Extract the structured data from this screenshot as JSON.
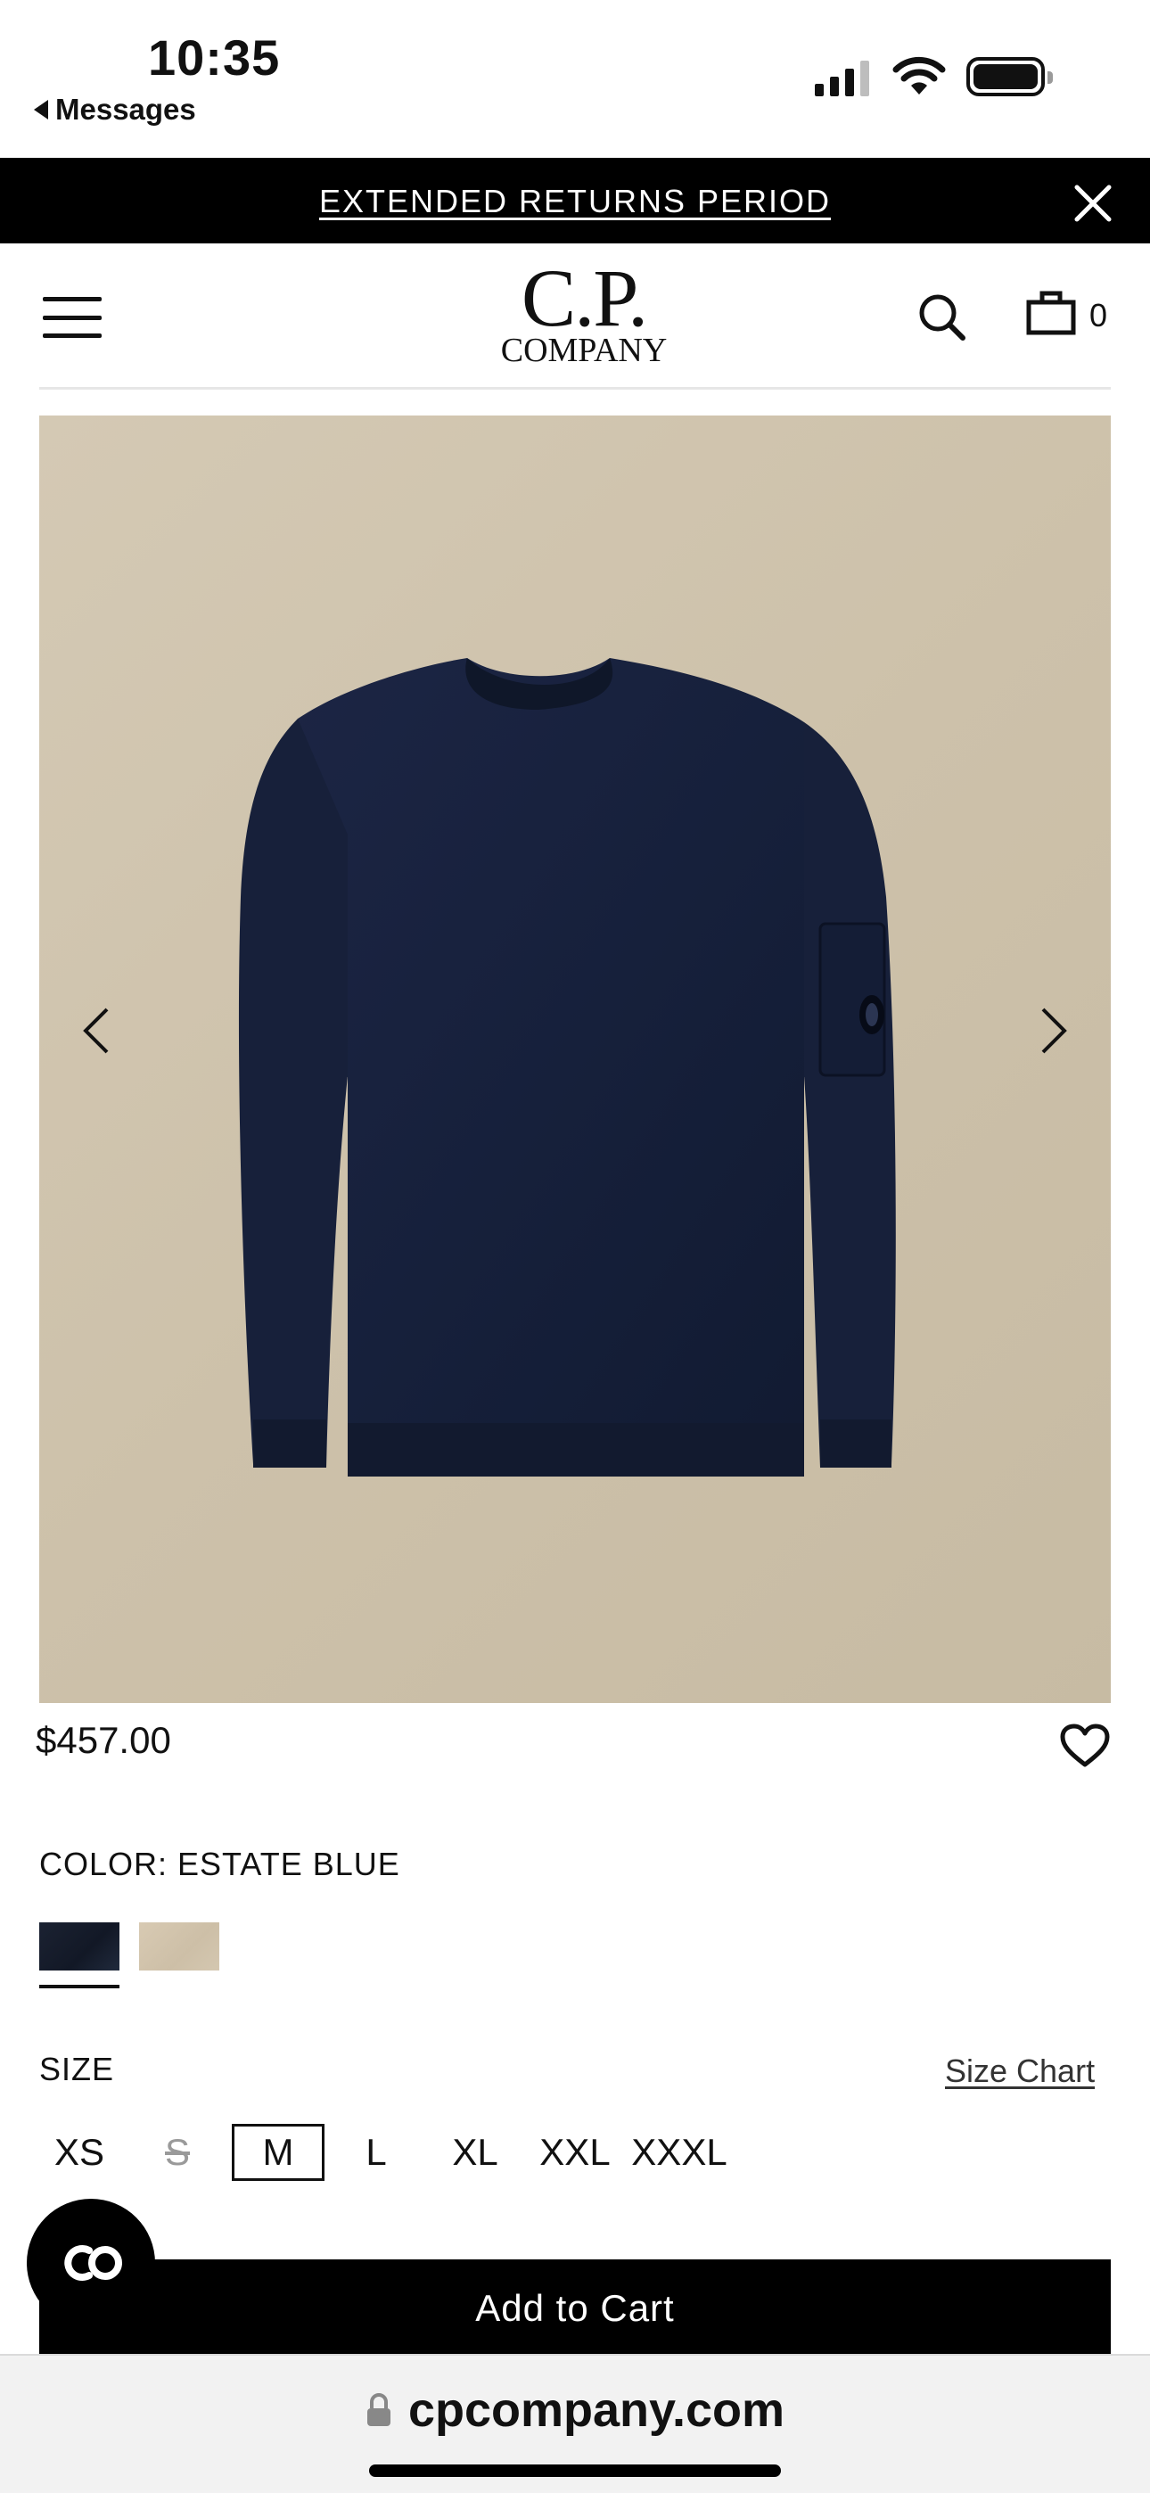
{
  "status_bar": {
    "time": "10:35",
    "back_label": "Messages",
    "icons": [
      "cellular-signal-icon",
      "wifi-icon",
      "battery-icon"
    ]
  },
  "promo": {
    "text": "EXTENDED RETURNS PERIOD",
    "close_icon": "close-icon"
  },
  "header": {
    "logo_top": "C.P.",
    "logo_bottom": "COMPANY",
    "cart_count": "0",
    "icons": [
      "menu-icon",
      "search-icon",
      "bag-icon"
    ]
  },
  "product": {
    "image_icon": "sweater-image",
    "price": "$457.00",
    "color_label": "COLOR: ESTATE BLUE",
    "colors": [
      "#141b2b",
      "#d2c5ae"
    ],
    "size_label": "SIZE",
    "size_chart_label": "Size Chart",
    "sizes": [
      {
        "label": "XS",
        "state": "available"
      },
      {
        "label": "S",
        "state": "unavailable"
      },
      {
        "label": "M",
        "state": "selected"
      },
      {
        "label": "L",
        "state": "available"
      },
      {
        "label": "XL",
        "state": "available"
      },
      {
        "label": "XXL",
        "state": "available"
      },
      {
        "label": "XXXL",
        "state": "available"
      }
    ],
    "add_to_cart_label": "Add to Cart"
  },
  "browser": {
    "url": "cpcompany.com"
  },
  "colors": {
    "banner_bg": "#000000",
    "image_bg": "#cdc1aa",
    "sweater": "#1a2340"
  }
}
